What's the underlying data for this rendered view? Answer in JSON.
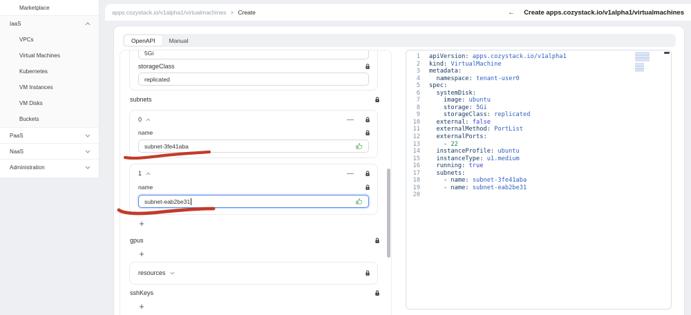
{
  "colors": {
    "accent_blue": "#4c86e8",
    "annotation_red": "#c23b2b",
    "thumb_green": "#5fae68",
    "yaml_key_navy": "#173a63",
    "yaml_value_blue": "#3061c0"
  },
  "sidebar": {
    "items": [
      {
        "label": "Marketplace"
      },
      {
        "label": "IaaS"
      },
      {
        "label": "VPCs"
      },
      {
        "label": "Virtual Machines"
      },
      {
        "label": "Kubernetes"
      },
      {
        "label": "VM Instances"
      },
      {
        "label": "VM Disks"
      },
      {
        "label": "Buckets"
      },
      {
        "label": "PaaS"
      },
      {
        "label": "NaaS"
      },
      {
        "label": "Administration"
      }
    ]
  },
  "header": {
    "breadcrumb_path": "apps.cozystack.io/v1alpha1/virtualmachines",
    "breadcrumb_separator": ">",
    "breadcrumb_current": "Create",
    "back_arrow": "←",
    "title": "Create apps.cozystack.io/v1alpha1/virtualmachines"
  },
  "tabs": {
    "openapi": "OpenAPI",
    "manual": "Manual"
  },
  "form": {
    "storage_value": "5Gi",
    "storage_class_label": "storageClass",
    "storage_class_value": "replicated",
    "subnets_label": "subnets",
    "subnet_items": [
      {
        "index": "0",
        "name_label": "name",
        "value": "subnet-3fe41aba"
      },
      {
        "index": "1",
        "name_label": "name",
        "value": "subnet-eab2be31"
      }
    ],
    "gpus_label": "gpus",
    "resources_label": "resources",
    "sshkeys_label": "sshKeys",
    "add_button": "+",
    "remove_button": "—"
  },
  "editor": {
    "lines": [
      {
        "n": "1",
        "tokens": [
          [
            "key",
            "apiVersion:"
          ],
          [
            "val",
            " apps.cozystack.io/v1alpha1"
          ]
        ]
      },
      {
        "n": "2",
        "tokens": [
          [
            "key",
            "kind:"
          ],
          [
            "val",
            " VirtualMachine"
          ]
        ]
      },
      {
        "n": "3",
        "tokens": [
          [
            "key",
            "metadata:"
          ]
        ]
      },
      {
        "n": "4",
        "tokens": [
          [
            "plain",
            "  "
          ],
          [
            "key",
            "namespace:"
          ],
          [
            "val",
            " tenant-user0"
          ]
        ]
      },
      {
        "n": "5",
        "tokens": [
          [
            "key",
            "spec:"
          ]
        ]
      },
      {
        "n": "6",
        "tokens": [
          [
            "plain",
            "  "
          ],
          [
            "key",
            "systemDisk:"
          ]
        ]
      },
      {
        "n": "7",
        "tokens": [
          [
            "plain",
            "    "
          ],
          [
            "key",
            "image:"
          ],
          [
            "val",
            " ubuntu"
          ]
        ]
      },
      {
        "n": "8",
        "tokens": [
          [
            "plain",
            "    "
          ],
          [
            "key",
            "storage:"
          ],
          [
            "val",
            " 5Gi"
          ]
        ]
      },
      {
        "n": "9",
        "tokens": [
          [
            "plain",
            "    "
          ],
          [
            "key",
            "storageClass:"
          ],
          [
            "val",
            " replicated"
          ]
        ]
      },
      {
        "n": "10",
        "tokens": [
          [
            "plain",
            "  "
          ],
          [
            "key",
            "external:"
          ],
          [
            "bool",
            " false"
          ]
        ]
      },
      {
        "n": "11",
        "tokens": [
          [
            "plain",
            "  "
          ],
          [
            "key",
            "externalMethod:"
          ],
          [
            "val",
            " PortList"
          ]
        ]
      },
      {
        "n": "12",
        "tokens": [
          [
            "plain",
            "  "
          ],
          [
            "key",
            "externalPorts:"
          ]
        ]
      },
      {
        "n": "13",
        "tokens": [
          [
            "plain",
            "    "
          ],
          [
            "dash",
            "- "
          ],
          [
            "num",
            "22"
          ]
        ]
      },
      {
        "n": "14",
        "tokens": [
          [
            "plain",
            "  "
          ],
          [
            "key",
            "instanceProfile:"
          ],
          [
            "val",
            " ubuntu"
          ]
        ]
      },
      {
        "n": "15",
        "tokens": [
          [
            "plain",
            "  "
          ],
          [
            "key",
            "instanceType:"
          ],
          [
            "val",
            " u1.medium"
          ]
        ]
      },
      {
        "n": "16",
        "tokens": [
          [
            "plain",
            "  "
          ],
          [
            "key",
            "running:"
          ],
          [
            "bool",
            " true"
          ]
        ]
      },
      {
        "n": "17",
        "tokens": [
          [
            "plain",
            "  "
          ],
          [
            "key",
            "subnets:"
          ]
        ]
      },
      {
        "n": "18",
        "tokens": [
          [
            "plain",
            "    "
          ],
          [
            "dash",
            "- "
          ],
          [
            "key",
            "name:"
          ],
          [
            "val",
            " subnet-3fe41aba"
          ]
        ]
      },
      {
        "n": "19",
        "tokens": [
          [
            "plain",
            "    "
          ],
          [
            "dash",
            "- "
          ],
          [
            "key",
            "name:"
          ],
          [
            "val",
            " subnet-eab2be31"
          ]
        ]
      },
      {
        "n": "20",
        "tokens": []
      }
    ]
  }
}
